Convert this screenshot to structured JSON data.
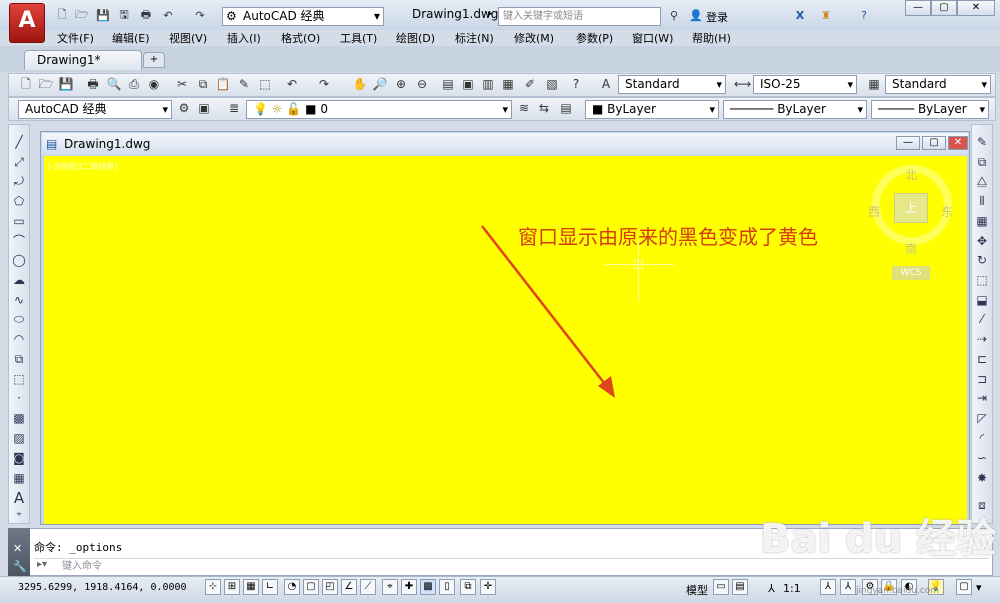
{
  "title_bar": {
    "app_button": "A",
    "workspace_select": "AutoCAD 经典",
    "document_title": "Drawing1.dwg",
    "search_placeholder": "键入关键字或短语",
    "login_label": "登录"
  },
  "menubar": {
    "items": [
      "文件(F)",
      "编辑(E)",
      "视图(V)",
      "插入(I)",
      "格式(O)",
      "工具(T)",
      "绘图(D)",
      "标注(N)",
      "修改(M)",
      "参数(P)",
      "窗口(W)",
      "帮助(H)"
    ]
  },
  "tabs": {
    "active_label": "Drawing1*"
  },
  "toolbar1": {
    "text_style": "Standard",
    "dim_style": "ISO-25",
    "table_style": "Standard"
  },
  "toolbar2": {
    "workspace": "AutoCAD 经典",
    "layer": "0",
    "color": "ByLayer",
    "linetype": "ByLayer",
    "lineweight": "ByLayer"
  },
  "drawing_window": {
    "title": "Drawing1.dwg",
    "viewport_label": "[-][俯视][二维线框]",
    "canvas_color": "#ffff00",
    "annotation": "窗口显示由原来的黑色变成了黄色",
    "annotation_color": "#d33d10",
    "viewcube": {
      "north": "北",
      "south": "南",
      "east": "东",
      "west": "西",
      "center": "上",
      "wcs": "WCS"
    }
  },
  "command": {
    "history_line": "命令: _options",
    "input_placeholder": "键入命令"
  },
  "status_bar": {
    "coordinates": "3295.6299, 1918.4164, 0.0000",
    "model_label": "模型",
    "scale_label": "1:1"
  },
  "watermark": {
    "logo": "Bai du 经验",
    "url": "jingyan.baidu.com"
  }
}
